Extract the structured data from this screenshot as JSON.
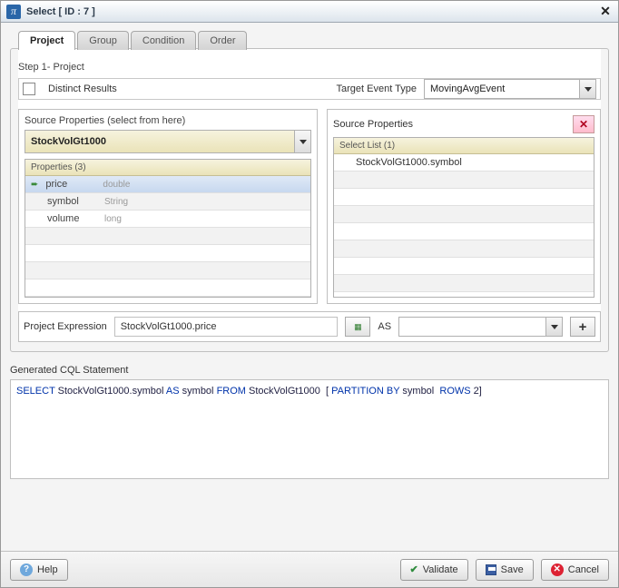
{
  "title": "Select [ ID : 7 ]",
  "tabs": [
    "Project",
    "Group",
    "Condition",
    "Order"
  ],
  "active_tab": 0,
  "step_label": "Step 1- Project",
  "distinct_label": "Distinct Results",
  "target_event_label": "Target Event Type",
  "target_event_value": "MovingAvgEvent",
  "left_panel_title": "Source Properties (select from here)",
  "source_select_value": "StockVolGt1000",
  "properties_header": "Properties (3)",
  "properties": [
    {
      "name": "price",
      "type": "double",
      "selected": true
    },
    {
      "name": "symbol",
      "type": "String",
      "selected": false
    },
    {
      "name": "volume",
      "type": "long",
      "selected": false
    }
  ],
  "right_panel_title": "Source Properties",
  "select_list_header": "Select List (1)",
  "select_list": [
    "StockVolGt1000.symbol"
  ],
  "proj_expr_label": "Project Expression",
  "proj_expr_value": "StockVolGt1000.price",
  "as_label": "AS",
  "as_value": "",
  "gen_label": "Generated CQL Statement",
  "cql": {
    "select": "SELECT",
    "expr": "StockVolGt1000.symbol",
    "as": "AS",
    "alias": "symbol",
    "from": "FROM",
    "src": "StockVolGt1000",
    "open": "[",
    "part": "PARTITION BY",
    "partcol": "symbol",
    "rows": "ROWS",
    "n": "2",
    "close": "]"
  },
  "buttons": {
    "help": "Help",
    "validate": "Validate",
    "save": "Save",
    "cancel": "Cancel"
  }
}
